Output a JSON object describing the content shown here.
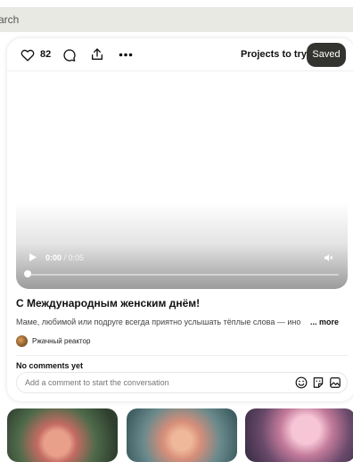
{
  "search": {
    "placeholder": "arch"
  },
  "actions": {
    "like_count": "82",
    "projects_label": "Projects to try",
    "saved_label": "Saved"
  },
  "video": {
    "current_time": "0:00",
    "duration": "/ 0:05",
    "progress": 0
  },
  "pin": {
    "title": "С Международным женским днём!",
    "description": "Маме, любимой или подруге всегда приятно услышать тёплые слова — иногд",
    "more_label": "... more",
    "author": "Ржачный реактор"
  },
  "comments": {
    "heading": "No comments yet",
    "placeholder": "Add a comment to start the conversation"
  },
  "icons": [
    "heart-icon",
    "comment-icon",
    "share-icon",
    "more-icon",
    "play-icon",
    "volume-icon",
    "emoji-icon",
    "sticker-icon",
    "image-icon"
  ]
}
